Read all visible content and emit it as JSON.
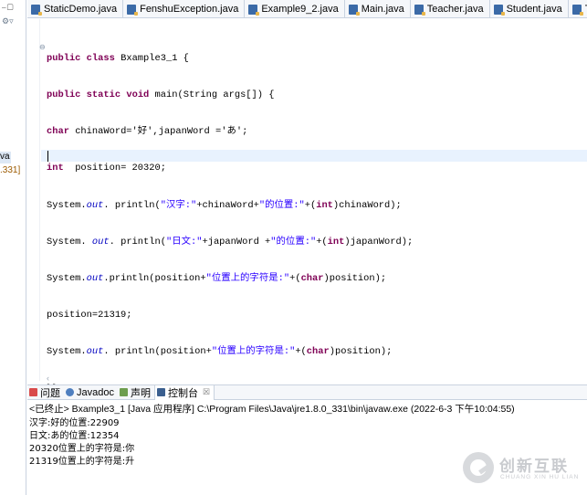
{
  "left_panel": {
    "fragment_1": "va",
    "fragment_2": ".331]"
  },
  "editor_tabs": [
    {
      "label": "StaticDemo.java"
    },
    {
      "label": "FenshuException.java"
    },
    {
      "label": "Example9_2.java"
    },
    {
      "label": "Main.java"
    },
    {
      "label": "Teacher.java"
    },
    {
      "label": "Student.java"
    },
    {
      "label": "T"
    }
  ],
  "code": {
    "line1": {
      "kw1": "public",
      "kw2": "class",
      "rest": " Bxample3_1 {"
    },
    "line2": {
      "kw1": "public",
      "kw2": "static",
      "kw3": "void",
      "rest": " main(String args[]) {"
    },
    "line3": {
      "kw1": "char",
      "rest": " chinaWord='好',japanWord ='あ';"
    },
    "line4": {
      "kw1": "int",
      "rest": "  position= 20320;"
    },
    "line5": {
      "a": "System.",
      "out": "out",
      "b": ". println(",
      "s1": "\"汉字:\"",
      "c": "+chinaWord+",
      "s2": "\"的位置:\"",
      "d": "+(",
      "kw": "int",
      "e": ")chinaWord);"
    },
    "line6": {
      "a": "System. ",
      "out": "out",
      "b": ". println(",
      "s1": "\"日文:\"",
      "c": "+japanWord +",
      "s2": "\"的位置:\"",
      "d": "+(",
      "kw": "int",
      "e": ")japanWord);"
    },
    "line7": {
      "a": "System.",
      "out": "out",
      "b": ".println(position+",
      "s1": "\"位置上的字符是:\"",
      "d": "+(",
      "kw": "char",
      "e": ")position);"
    },
    "line8": {
      "rest": "position=21319;"
    },
    "line9": {
      "a": "System.",
      "out": "out",
      "b": ". println(position+",
      "s1": "\"位置上的字符是:\"",
      "d": "+(",
      "kw": "char",
      "e": ")position);"
    },
    "line10": {
      "rest": "}}"
    }
  },
  "bottom_tabs": [
    {
      "label": "问题",
      "icon": "problems-icon"
    },
    {
      "label": "Javadoc",
      "icon": "javadoc-icon"
    },
    {
      "label": "声明",
      "icon": "declaration-icon"
    },
    {
      "label": "控制台",
      "icon": "console-icon",
      "close": "☒"
    }
  ],
  "console": {
    "terminated": "<已终止> Bxample3_1 [Java 应用程序] C:\\Program Files\\Java\\jre1.8.0_331\\bin\\javaw.exe  (2022-6-3 下午10:04:55)",
    "lines": [
      "汉字:好的位置:22909",
      "日文:あ的位置:12354",
      "20320位置上的字符是:你",
      "21319位置上的字符是:升"
    ]
  },
  "watermark": {
    "zh": "创新互联",
    "en": "CHUANG XIN HU LIAN"
  },
  "colors": {
    "keyword": "#7f0055",
    "string": "#2a00ff",
    "static_field": "#0000c0",
    "current_line": "#e8f2fe"
  }
}
